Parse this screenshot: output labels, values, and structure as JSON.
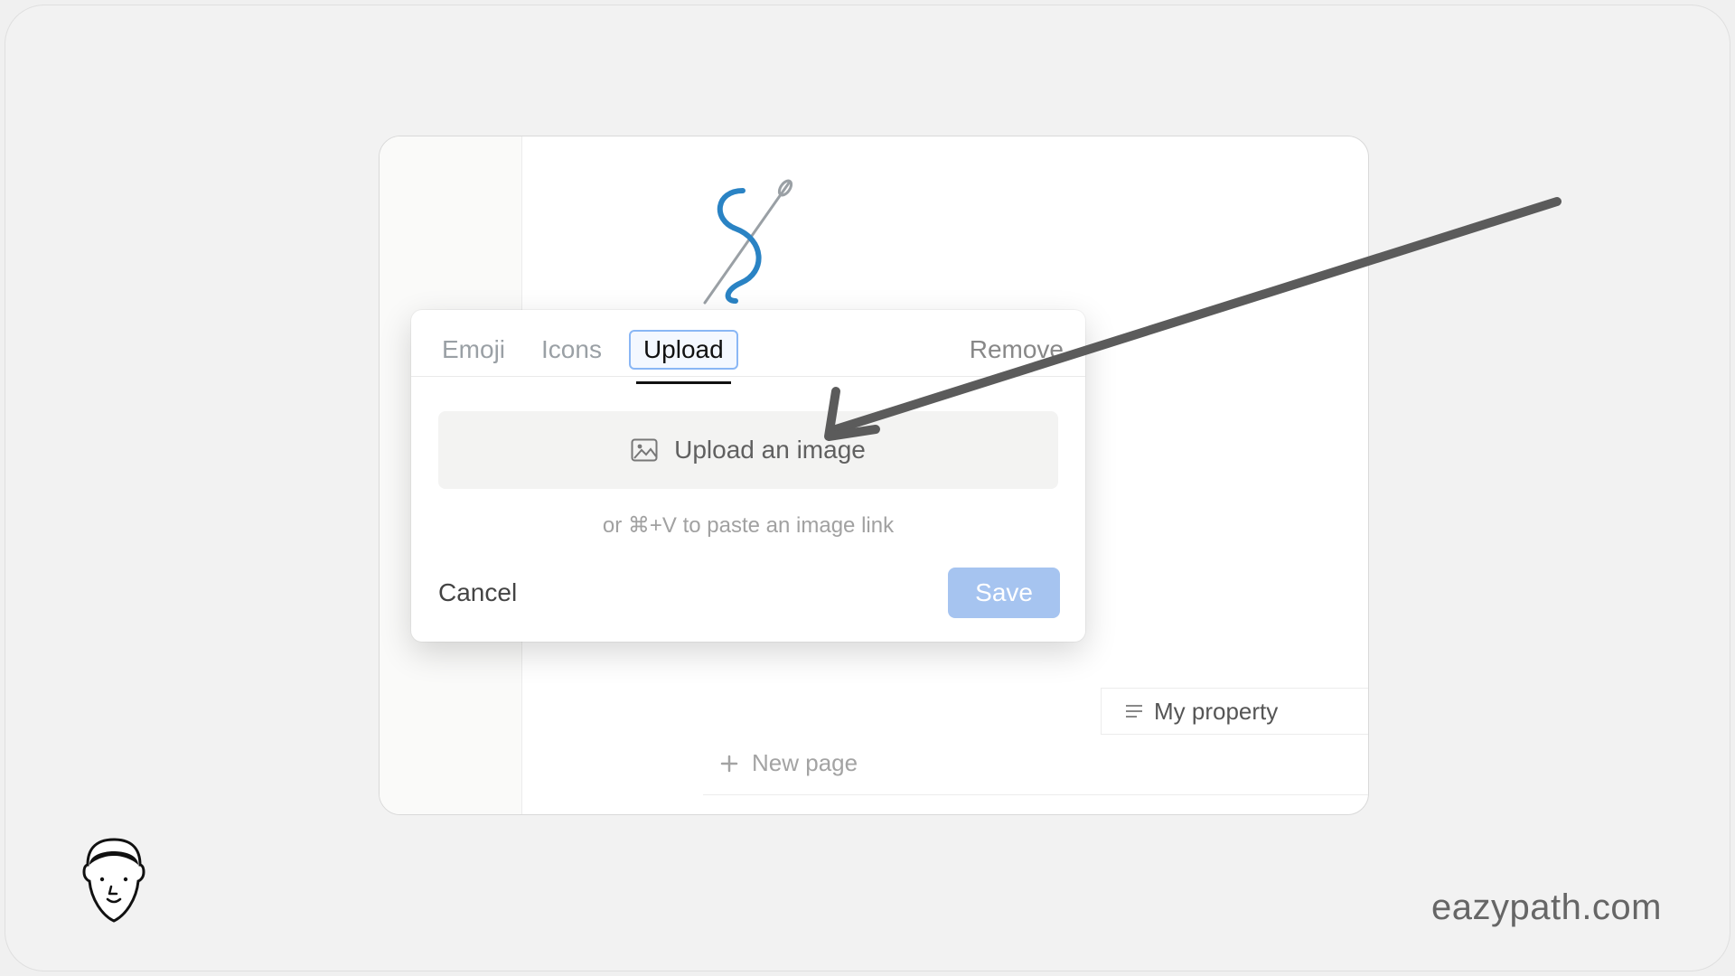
{
  "popover": {
    "tabs": {
      "emoji": "Emoji",
      "icons": "Icons",
      "upload": "Upload"
    },
    "remove": "Remove",
    "upload_button": "Upload an image",
    "hint": "or ⌘+V to paste an image link",
    "cancel": "Cancel",
    "save": "Save"
  },
  "page": {
    "new_page": "New page",
    "property_label": "My property"
  },
  "watermark": "eazypath.com"
}
